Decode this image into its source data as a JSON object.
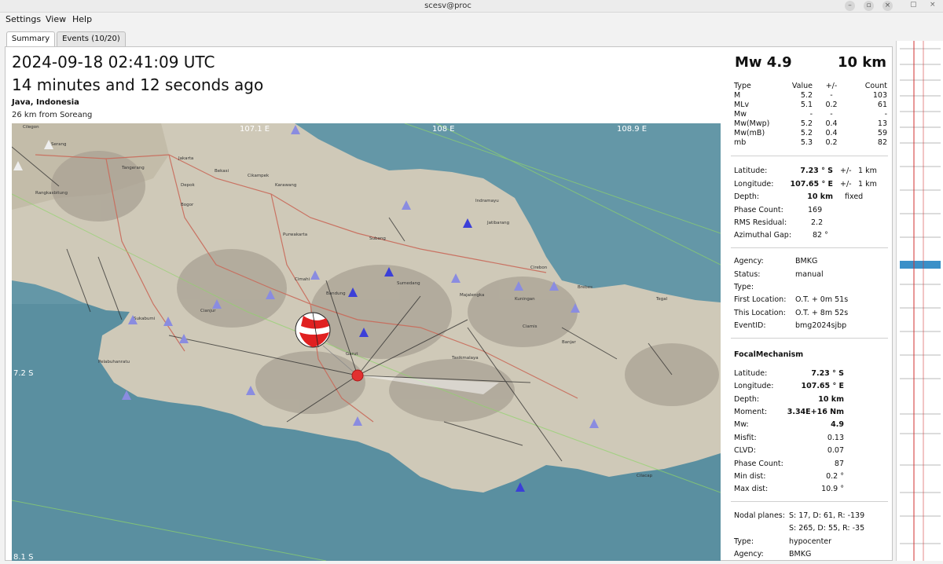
{
  "window": {
    "title": "scesv@proc"
  },
  "menu": [
    "Settings",
    "View",
    "Help"
  ],
  "tabs": [
    {
      "label": "Summary"
    },
    {
      "label": "Events (10/20)"
    }
  ],
  "header": {
    "origin_time": "2024-09-18 02:41:09 UTC",
    "time_ago": "14 minutes and 12 seconds ago",
    "region": "Java, Indonesia",
    "nearest": "26 km from Soreang"
  },
  "map": {
    "lon_labels": [
      "107.1 E",
      "108 E",
      "108.9 E"
    ],
    "lat_labels": [
      "7.2 S",
      "8.1 S"
    ],
    "places": [
      "Cilegon",
      "Serang",
      "Tangerang",
      "Jakarta",
      "Bekasi",
      "Depok",
      "Bogor",
      "Cikampek",
      "Karawang",
      "Purwakarta",
      "Subang",
      "Indramayu",
      "Jatibarang",
      "Cimahi",
      "Bandung",
      "Sumedang",
      "Majalengka",
      "Cirebon",
      "Kuningan",
      "Brebes",
      "Tegal",
      "Sukabumi",
      "Cianjur",
      "Garut",
      "Tasikmalaya",
      "Ciamis",
      "Banjar",
      "Cilacap",
      "Pelabuhanratu",
      "Rangkasbitung"
    ],
    "ocean_color": "#5a8fa0",
    "land_color": "#cfc9b8",
    "epicenter_color": "#e23030",
    "station_color": "#3b3fd8"
  },
  "magnitude": {
    "title": "Mw 4.9",
    "depth": "10 km",
    "columns": [
      "Type",
      "Value",
      "+/-",
      "Count"
    ],
    "rows": [
      {
        "type": "M",
        "value": "5.2",
        "unc": "-",
        "count": "103"
      },
      {
        "type": "MLv",
        "value": "5.1",
        "unc": "0.2",
        "count": "61"
      },
      {
        "type": "Mw",
        "value": "-",
        "unc": "-",
        "count": "-"
      },
      {
        "type": "Mw(Mwp)",
        "value": "5.2",
        "unc": "0.4",
        "count": "13"
      },
      {
        "type": "Mw(mB)",
        "value": "5.2",
        "unc": "0.4",
        "count": "59"
      },
      {
        "type": "mb",
        "value": "5.3",
        "unc": "0.2",
        "count": "82"
      }
    ]
  },
  "origin": {
    "lat_label": "Latitude:",
    "lat": "7.23 ° S",
    "lat_pm": "+/-",
    "lat_unc": "1 km",
    "lon_label": "Longitude:",
    "lon": "107.65 ° E",
    "lon_pm": "+/-",
    "lon_unc": "1 km",
    "depth_label": "Depth:",
    "depth": "10 km",
    "depth_mode": "fixed",
    "phase_label": "Phase Count:",
    "phase": "169",
    "rms_label": "RMS Residual:",
    "rms": "2.2",
    "gap_label": "Azimuthal Gap:",
    "gap": "82 °"
  },
  "info": {
    "agency_label": "Agency:",
    "agency": "BMKG",
    "status_label": "Status:",
    "status": "manual",
    "type_label": "Type:",
    "type": "",
    "first_label": "First Location:",
    "first": "O.T. + 0m 51s",
    "this_label": "This Location:",
    "this": "O.T. + 8m 52s",
    "event_label": "EventID:",
    "event": "bmg2024sjbp"
  },
  "focal": {
    "title": "FocalMechanism",
    "lat_label": "Latitude:",
    "lat": "7.23 ° S",
    "lon_label": "Longitude:",
    "lon": "107.65 ° E",
    "depth_label": "Depth:",
    "depth": "10 km",
    "moment_label": "Moment:",
    "moment": "3.34E+16 Nm",
    "mw_label": "Mw:",
    "mw": "4.9",
    "misfit_label": "Misfit:",
    "misfit": "0.13",
    "clvd_label": "CLVD:",
    "clvd": "0.07",
    "phase_label": "Phase Count:",
    "phase": "87",
    "mindist_label": "Min dist:",
    "mindist": "0.2 °",
    "maxdist_label": "Max dist:",
    "maxdist": "10.9 °",
    "nodal_label": "Nodal planes:",
    "np1": "S: 17, D: 61, R: -139",
    "np2": "S: 265, D: 55, R: -35",
    "type_label": "Type:",
    "type": "hypocenter",
    "agency_label": "Agency:",
    "agency": "BMKG"
  }
}
